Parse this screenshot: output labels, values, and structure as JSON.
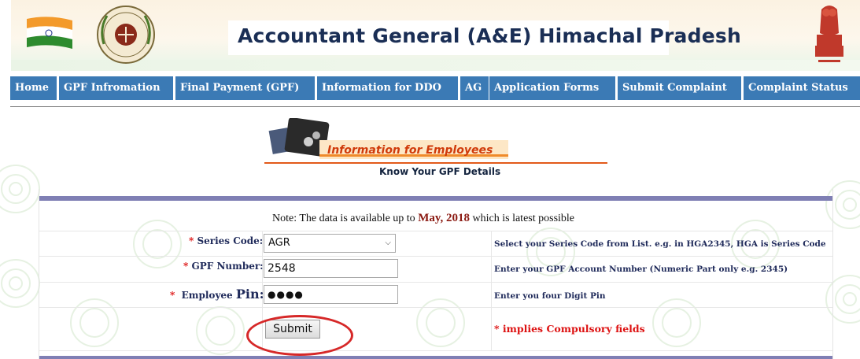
{
  "header": {
    "title": "Accountant General (A&E) Himachal Pradesh"
  },
  "nav": {
    "items": [
      {
        "label": "Home"
      },
      {
        "label": "GPF Infromation"
      },
      {
        "label": "Final Payment (GPF)"
      },
      {
        "label": "Information for DDO"
      },
      {
        "label": "AG"
      },
      {
        "label": "Application Forms"
      },
      {
        "label": "Submit Complaint"
      },
      {
        "label": "Complaint Status"
      }
    ],
    "color": "#3b7ab5"
  },
  "banner": {
    "title": "Information for Employees",
    "subtitle": "Know Your GPF Details"
  },
  "note": {
    "prefix": "Note: The data is available up to ",
    "date": "May, 2018",
    "suffix": " which is latest possible"
  },
  "form": {
    "series_code": {
      "label": "Series Code:",
      "value": "AGR",
      "help": "Select your Series Code from List. e.g. in HGA2345, HGA is Series Code"
    },
    "gpf_number": {
      "label": "GPF Number:",
      "value": "2548",
      "help": "Enter your GPF Account Number (Numeric Part only e.g. 2345)"
    },
    "employee_pin": {
      "label_prefix": "Employee",
      "label_big": "Pin:",
      "value": "●●●●",
      "help": "Enter you four Digit Pin"
    },
    "required_mark": "*",
    "submit_label": "Submit",
    "compulsory_note": "* implies Compulsory fields"
  },
  "colors": {
    "required": "#dd1111",
    "highlight_circle": "#d62828",
    "panel_bar": "#7f7fb4"
  }
}
